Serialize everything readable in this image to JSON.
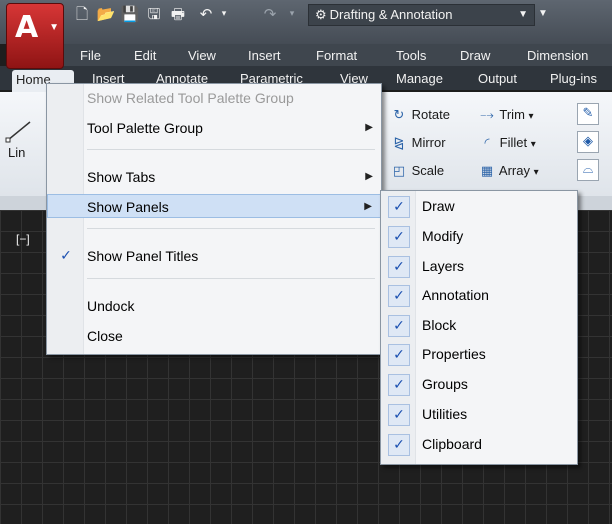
{
  "quick_access": {
    "workspace": "Drafting & Annotation"
  },
  "menubar": {
    "items": [
      "File",
      "Edit",
      "View",
      "Insert",
      "Format",
      "Tools",
      "Draw",
      "Dimension"
    ]
  },
  "ribbon_tabs": [
    "Home",
    "Insert",
    "Annotate",
    "Parametric",
    "View",
    "Manage",
    "Output",
    "Plug-ins"
  ],
  "ribbon": {
    "line_label": "Lin",
    "modify": [
      {
        "label": "Rotate",
        "icon": "rotate-icon"
      },
      {
        "label": "Mirror",
        "icon": "mirror-icon"
      },
      {
        "label": "Scale",
        "icon": "scale-icon"
      },
      {
        "label": "Trim",
        "icon": "trim-icon"
      },
      {
        "label": "Fillet",
        "icon": "fillet-icon"
      },
      {
        "label": "Array",
        "icon": "array-icon"
      }
    ]
  },
  "viewport": {
    "label": "[−]"
  },
  "context_menu": {
    "items": [
      {
        "label": "Show Related Tool Palette Group",
        "disabled": true
      },
      {
        "label": "Tool Palette Group",
        "submenu": true
      },
      {
        "label": "Show Tabs",
        "submenu": true
      },
      {
        "label": "Show Panels",
        "submenu": true,
        "highlighted": true
      },
      {
        "label": "Show Panel Titles",
        "checked": true
      },
      {
        "label": "Undock"
      },
      {
        "label": "Close"
      }
    ]
  },
  "panels_submenu": {
    "items": [
      "Draw",
      "Modify",
      "Layers",
      "Annotation",
      "Block",
      "Properties",
      "Groups",
      "Utilities",
      "Clipboard"
    ]
  },
  "colors": {
    "titlebar": "#4f565f",
    "app_button": "#c42a2a",
    "canvas": "#1f1f1f",
    "menu_highlight": "#cfe0f5",
    "check": "#1a4fb0"
  }
}
